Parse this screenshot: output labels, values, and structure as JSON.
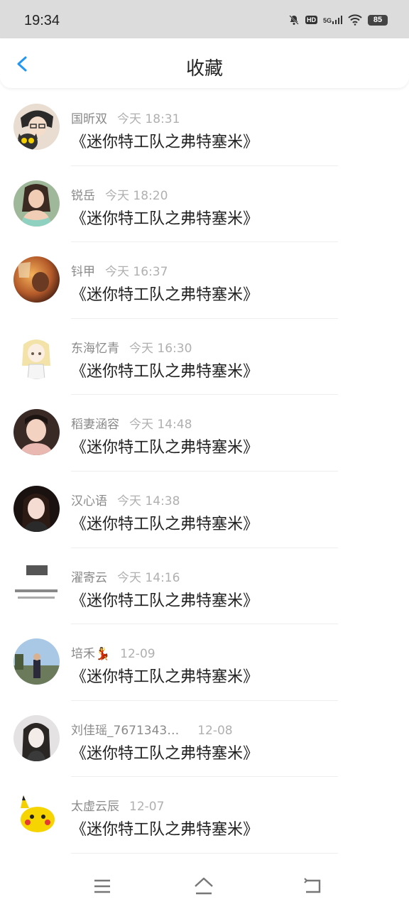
{
  "status_bar": {
    "time": "19:34",
    "battery": "85",
    "network": "5G",
    "hd": "HD"
  },
  "header": {
    "title": "收藏"
  },
  "items": [
    {
      "name": "国昕双",
      "time": "今天 18:31",
      "subject": "《迷你特工队之弗特塞米》",
      "avatar": "anime-avatar"
    },
    {
      "name": "锐岳",
      "time": "今天 18:20",
      "subject": "《迷你特工队之弗特塞米》",
      "avatar": "photo-avatar"
    },
    {
      "name": "钭甲",
      "time": "今天 16:37",
      "subject": "《迷你特工队之弗特塞米》",
      "avatar": "art-avatar"
    },
    {
      "name": "东海忆青",
      "time": "今天 16:30",
      "subject": "《迷你特工队之弗特塞米》",
      "avatar": "anime-avatar"
    },
    {
      "name": "稻妻涵容",
      "time": "今天 14:48",
      "subject": "《迷你特工队之弗特塞米》",
      "avatar": "photo-avatar"
    },
    {
      "name": "汉心语",
      "time": "今天 14:38",
      "subject": "《迷你特工队之弗特塞米》",
      "avatar": "photo-avatar"
    },
    {
      "name": "濯寄云",
      "time": "今天 14:16",
      "subject": "《迷你特工队之弗特塞米》",
      "avatar": "text-avatar"
    },
    {
      "name": "培禾💃",
      "time": "12-09",
      "subject": "《迷你特工队之弗特塞米》",
      "avatar": "photo-avatar"
    },
    {
      "name": "刘佳瑶_7671343…",
      "time": "12-08",
      "subject": "《迷你特工队之弗特塞米》",
      "avatar": "art-avatar"
    },
    {
      "name": "太虚云辰",
      "time": "12-07",
      "subject": "《迷你特工队之弗特塞米》",
      "avatar": "pikachu-avatar"
    }
  ],
  "colors": {
    "accent": "#2196f3",
    "statusbar_bg": "#dcdcdc",
    "name": "#8a8a8a",
    "time": "#b0b0b0",
    "text": "#222222"
  },
  "nav_icons": [
    "menu-icon",
    "home-icon",
    "back-icon"
  ]
}
